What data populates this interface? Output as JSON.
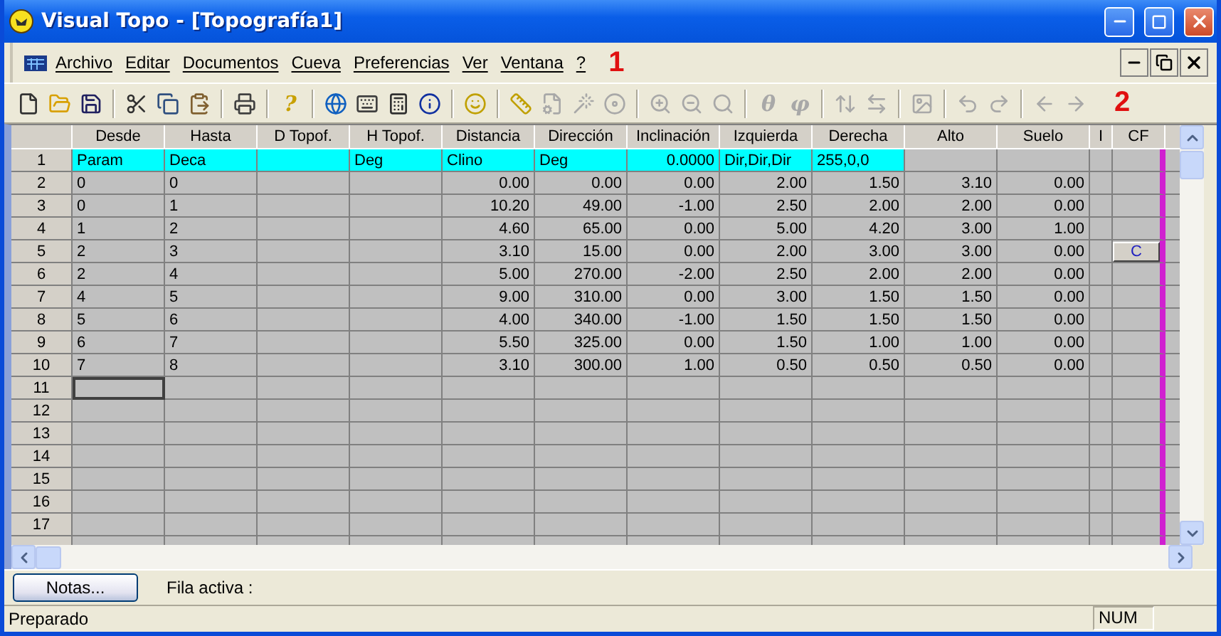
{
  "window": {
    "title": "Visual Topo - [Topografía1]"
  },
  "menu": {
    "items": [
      "Archivo",
      "Editar",
      "Documentos",
      "Cueva",
      "Preferencias",
      "Ver",
      "Ventana",
      "?"
    ],
    "annotation": "1"
  },
  "toolbar": {
    "annotation": "2",
    "groups": [
      [
        {
          "disabled": false
        },
        {
          "disabled": false
        },
        {
          "disabled": false
        }
      ],
      [
        {
          "disabled": false
        },
        {
          "disabled": false
        },
        {
          "disabled": false
        }
      ],
      [
        {
          "disabled": false
        }
      ],
      [
        {
          "glyph": "?",
          "disabled": false
        }
      ],
      [
        {
          "disabled": false
        },
        {
          "disabled": false
        },
        {
          "disabled": false
        },
        {
          "disabled": false
        }
      ],
      [
        {
          "disabled": false
        }
      ],
      [
        {
          "disabled": false
        },
        {
          "disabled": true
        },
        {
          "disabled": true
        },
        {
          "disabled": true
        }
      ],
      [
        {
          "disabled": true
        },
        {
          "disabled": true
        },
        {
          "disabled": true
        }
      ],
      [
        {
          "glyph": "θ",
          "disabled": true
        },
        {
          "glyph": "φ",
          "disabled": true
        }
      ],
      [
        {
          "disabled": true
        },
        {
          "disabled": true
        }
      ],
      [
        {
          "disabled": true
        }
      ],
      [
        {
          "disabled": true
        },
        {
          "disabled": true
        }
      ],
      [
        {
          "disabled": true
        },
        {
          "disabled": true
        }
      ]
    ]
  },
  "grid": {
    "columns": [
      {
        "label": "Desde",
        "kind": "text",
        "parameter": true
      },
      {
        "label": "Hasta",
        "kind": "text",
        "parameter": true
      },
      {
        "label": "D Topof.",
        "kind": "text",
        "parameter": true
      },
      {
        "label": "H Topof.",
        "kind": "text",
        "parameter": true
      },
      {
        "label": "Distancia",
        "kind": "number",
        "parameter": true
      },
      {
        "label": "Dirección",
        "kind": "number",
        "parameter": true
      },
      {
        "label": "Inclinación",
        "kind": "number",
        "parameter": true
      },
      {
        "label": "Izquierda",
        "kind": "number",
        "parameter": true
      },
      {
        "label": "Derecha",
        "kind": "number",
        "parameter": true
      },
      {
        "label": "Alto",
        "kind": "number",
        "parameter": false
      },
      {
        "label": "Suelo",
        "kind": "number",
        "parameter": false
      },
      {
        "label": "I",
        "kind": "flag",
        "parameter": false
      },
      {
        "label": "CF",
        "kind": "button",
        "parameter": false
      }
    ],
    "rows": [
      {
        "label": "1",
        "kind": "parameters",
        "selected": false,
        "cells": [
          "Param",
          "Deca",
          null,
          "Deg",
          "Clino",
          "Deg",
          {
            "text": "0.0000",
            "kind": "number"
          },
          "Dir,Dir,Dir",
          "255,0,0",
          null,
          null,
          null,
          null
        ]
      },
      {
        "label": "2",
        "kind": "shot",
        "selected": false,
        "cells": [
          "0",
          "0",
          null,
          null,
          "0.00",
          "0.00",
          "0.00",
          "2.00",
          "1.50",
          "3.10",
          "0.00",
          null,
          null
        ]
      },
      {
        "label": "3",
        "kind": "shot",
        "selected": false,
        "cells": [
          "0",
          "1",
          null,
          null,
          "10.20",
          "49.00",
          "-1.00",
          "2.50",
          "2.00",
          "2.00",
          "0.00",
          null,
          null
        ]
      },
      {
        "label": "4",
        "kind": "shot",
        "selected": false,
        "cells": [
          "1",
          "2",
          null,
          null,
          "4.60",
          "65.00",
          "0.00",
          "5.00",
          "4.20",
          "3.00",
          "1.00",
          null,
          null
        ]
      },
      {
        "label": "5",
        "kind": "shot",
        "selected": false,
        "cells": [
          "2",
          "3",
          null,
          null,
          "3.10",
          "15.00",
          "0.00",
          "2.00",
          "3.00",
          "3.00",
          "0.00",
          null,
          "C"
        ]
      },
      {
        "label": "6",
        "kind": "shot",
        "selected": false,
        "cells": [
          "2",
          "4",
          null,
          null,
          "5.00",
          "270.00",
          "-2.00",
          "2.50",
          "2.00",
          "2.00",
          "0.00",
          null,
          null
        ]
      },
      {
        "label": "7",
        "kind": "shot",
        "selected": false,
        "cells": [
          "4",
          "5",
          null,
          null,
          "9.00",
          "310.00",
          "0.00",
          "3.00",
          "1.50",
          "1.50",
          "0.00",
          null,
          null
        ]
      },
      {
        "label": "8",
        "kind": "shot",
        "selected": false,
        "cells": [
          "5",
          "6",
          null,
          null,
          "4.00",
          "340.00",
          "-1.00",
          "1.50",
          "1.50",
          "1.50",
          "0.00",
          null,
          null
        ]
      },
      {
        "label": "9",
        "kind": "shot",
        "selected": false,
        "cells": [
          "6",
          "7",
          null,
          null,
          "5.50",
          "325.00",
          "0.00",
          "1.50",
          "1.00",
          "1.00",
          "0.00",
          null,
          null
        ]
      },
      {
        "label": "10",
        "kind": "shot",
        "selected": false,
        "cells": [
          "7",
          "8",
          null,
          null,
          "3.10",
          "300.00",
          "1.00",
          "0.50",
          "0.50",
          "0.50",
          "0.00",
          null,
          null
        ]
      },
      {
        "label": "11",
        "kind": "shot",
        "selected": true,
        "cells": []
      },
      {
        "label": "12",
        "kind": "shot",
        "selected": false,
        "cells": []
      },
      {
        "label": "13",
        "kind": "shot",
        "selected": false,
        "cells": []
      },
      {
        "label": "14",
        "kind": "shot",
        "selected": false,
        "cells": []
      },
      {
        "label": "15",
        "kind": "shot",
        "selected": false,
        "cells": []
      },
      {
        "label": "16",
        "kind": "shot",
        "selected": false,
        "cells": []
      },
      {
        "label": "17",
        "kind": "shot",
        "selected": false,
        "cells": []
      }
    ]
  },
  "notes": {
    "button": "Notas...",
    "active_row_label": "Fila activa :"
  },
  "status_bar": {
    "message": "Preparado",
    "num": "NUM"
  }
}
